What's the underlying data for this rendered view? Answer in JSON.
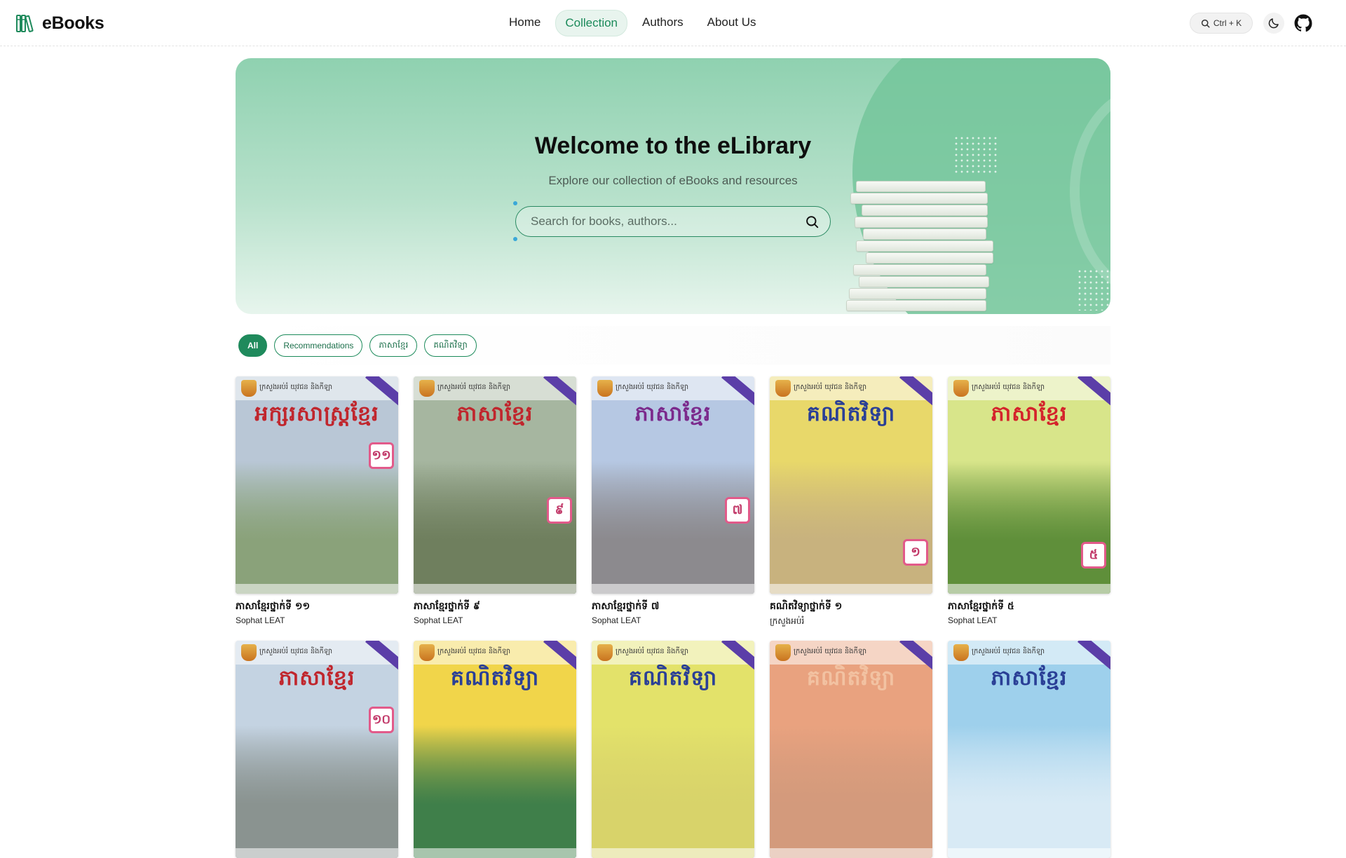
{
  "app": {
    "name": "eBooks",
    "logo_icon": "books-icon"
  },
  "nav": {
    "items": [
      {
        "label": "Home",
        "active": false
      },
      {
        "label": "Collection",
        "active": true
      },
      {
        "label": "Authors",
        "active": false
      },
      {
        "label": "About Us",
        "active": false
      }
    ]
  },
  "header_actions": {
    "search_shortcut": "Ctrl + K",
    "theme_icon": "moon-icon",
    "github_icon": "github-icon"
  },
  "hero": {
    "title": "Welcome to the eLibrary",
    "subtitle": "Explore our collection of eBooks and resources",
    "search_placeholder": "Search for books, authors..."
  },
  "filters": {
    "items": [
      {
        "label": "All",
        "active": true
      },
      {
        "label": "Recommendations",
        "active": false
      },
      {
        "label": "ភាសាខ្មែរ",
        "active": false
      },
      {
        "label": "គណិតវិទ្យា",
        "active": false
      }
    ]
  },
  "books": [
    {
      "title": "ភាសាខ្មែរថ្នាក់ទី ១១",
      "author": "Sophat LEAT",
      "cover_title": "អក្សរសាស្ត្រខ្មែរ",
      "cover_grade": "១១",
      "cover_color": "#b9c7d6",
      "title_color": "#c0262d",
      "art_color": "#8aa27a"
    },
    {
      "title": "ភាសាខ្មែរថ្នាក់ទី ៩",
      "author": "Sophat LEAT",
      "cover_title": "ភាសាខ្មែរ",
      "cover_grade": "៩",
      "cover_color": "#a6b6a0",
      "title_color": "#c0262d",
      "art_color": "#6f7f5e"
    },
    {
      "title": "ភាសាខ្មែរថ្នាក់ទី ៧",
      "author": "Sophat LEAT",
      "cover_title": "ភាសាខ្មែរ",
      "cover_grade": "៧",
      "cover_color": "#b6c8e3",
      "title_color": "#7b2a8c",
      "art_color": "#8c8a8e"
    },
    {
      "title": "គណិតវិទ្យាថ្នាក់ទី ១",
      "author": "ក្រសួងអប់រំ",
      "cover_title": "គណិតវិទ្យា",
      "cover_grade": "១",
      "cover_color": "#e8d86a",
      "title_color": "#2a3f96",
      "art_color": "#c8b27e"
    },
    {
      "title": "ភាសាខ្មែរថ្នាក់ទី ៥",
      "author": "Sophat LEAT",
      "cover_title": "ភាសាខ្មែរ",
      "cover_grade": "៥",
      "cover_color": "#d8e58a",
      "title_color": "#d4232b",
      "art_color": "#5f8f3a"
    },
    {
      "title": "",
      "author": "",
      "cover_title": "ភាសាខ្មែរ",
      "cover_grade": "១០",
      "cover_color": "#c4d3e2",
      "title_color": "#c0262d",
      "art_color": "#8a9390"
    },
    {
      "title": "",
      "author": "",
      "cover_title": "គណិតវិទ្យា",
      "cover_grade": "",
      "cover_color": "#f1d54a",
      "title_color": "#2a3f96",
      "art_color": "#3f7f4a"
    },
    {
      "title": "",
      "author": "",
      "cover_title": "គណិតវិទ្យា",
      "cover_grade": "",
      "cover_color": "#e3e26a",
      "title_color": "#2a3f96",
      "art_color": "#d8d36a"
    },
    {
      "title": "",
      "author": "",
      "cover_title": "គណិតវិទ្យា",
      "cover_grade": "",
      "cover_color": "#e9a27f",
      "title_color": "#f2c2a2",
      "art_color": "#d39a7c"
    },
    {
      "title": "",
      "author": "",
      "cover_title": "ភាសាខ្មែរ",
      "cover_grade": "",
      "cover_color": "#9ed0ec",
      "title_color": "#2a3f96",
      "art_color": "#d8eaf5"
    }
  ],
  "cover_common": {
    "ministry_text": "ក្រសួងអប់រំ យុវជន និងកីឡា"
  },
  "theme": {
    "accent": "#1f8a5c"
  }
}
